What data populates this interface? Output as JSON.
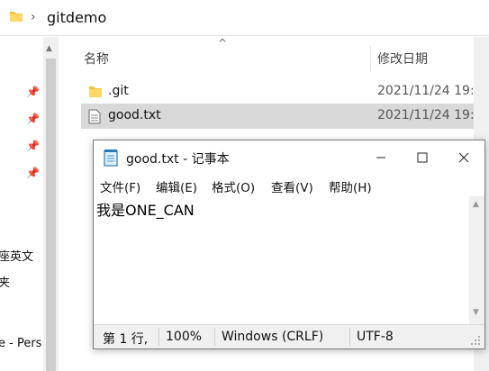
{
  "explorer": {
    "address_path": "gitdemo",
    "address_chevron": "›",
    "nav_clipped_labels": [
      "座英文",
      "夹",
      "e - Pers"
    ],
    "columns": {
      "name": "名称",
      "date_modified": "修改日期"
    },
    "files": [
      {
        "name": ".git",
        "date": "2021/11/24 19:1",
        "type": "folder"
      },
      {
        "name": "good.txt",
        "date": "2021/11/24 19:1",
        "type": "text-file"
      }
    ]
  },
  "notepad": {
    "title": "good.txt - 记事本",
    "menu": [
      "文件(F)",
      "编辑(E)",
      "格式(O)",
      "查看(V)",
      "帮助(H)"
    ],
    "content": "我是ONE_CAN",
    "status": {
      "position": "第 1 行,",
      "zoom": "100%",
      "line_ending": "Windows (CRLF)",
      "encoding": "UTF-8"
    }
  },
  "colors": {
    "selected_row": "#d9d9d9",
    "folder_yellow": "#f5c342",
    "status_bar": "#f0f0f0"
  }
}
